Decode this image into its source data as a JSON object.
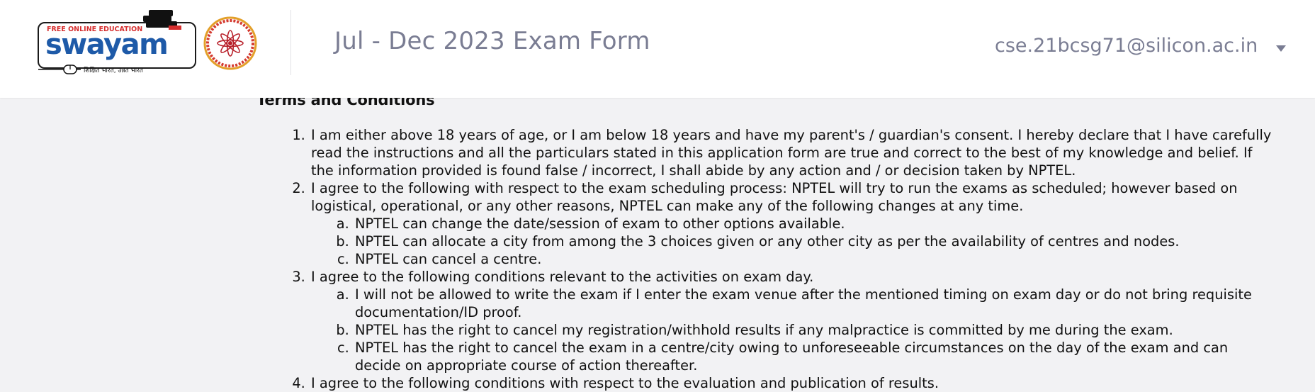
{
  "header": {
    "logo_tagline": "FREE ONLINE EDUCATION",
    "logo_name": "swayam",
    "logo_subtext": "शिक्षित भारत, उन्नत भारत",
    "exam_title": "Jul - Dec 2023 Exam Form",
    "user_email": "cse.21bcsg71@silicon.ac.in"
  },
  "terms": {
    "heading": "Terms and Conditions",
    "items": [
      {
        "text": "I am either above 18 years of age, or I am below 18 years and have my parent's / guardian's consent. I hereby declare that I have carefully read the instructions and all the particulars stated in this application form are true and correct to the best of my knowledge and belief. If the information provided is found false / incorrect, I shall abide by any action and / or decision taken by NPTEL.",
        "sub": []
      },
      {
        "text": "I agree to the following with respect to the exam scheduling process: NPTEL will try to run the exams as scheduled; however based on logistical, operational, or any other reasons, NPTEL can make any of the following changes at any time.",
        "sub": [
          "NPTEL can change the date/session of exam to other options available.",
          "NPTEL can allocate a city from among the 3 choices given or any other city as per the availability of centres and nodes.",
          "NPTEL can cancel a centre."
        ]
      },
      {
        "text": "I agree to the following conditions relevant to the activities on exam day.",
        "sub": [
          "I will not be allowed to write the exam if I enter the exam venue after the mentioned timing on exam day or do not bring requisite documentation/ID proof.",
          "NPTEL has the right to cancel my registration/withhold results if any malpractice is committed by me during the exam.",
          "NPTEL has the right to cancel the exam in a centre/city owing to unforeseeable circumstances on the day of the exam and can decide on appropriate course of action thereafter."
        ]
      },
      {
        "text": "I agree to the following conditions with respect to the evaluation and publication of results.",
        "sub": []
      }
    ]
  },
  "colors": {
    "swayam_blue": "#1e5aa8",
    "swayam_red": "#d62e2e",
    "title_gray": "#7a7d93",
    "page_bg": "#f2f2f4"
  },
  "icons": {
    "user_menu_caret": "caret-down-icon",
    "books": "books-icon",
    "mouse": "mouse-icon",
    "nptel": "nptel-logo"
  }
}
